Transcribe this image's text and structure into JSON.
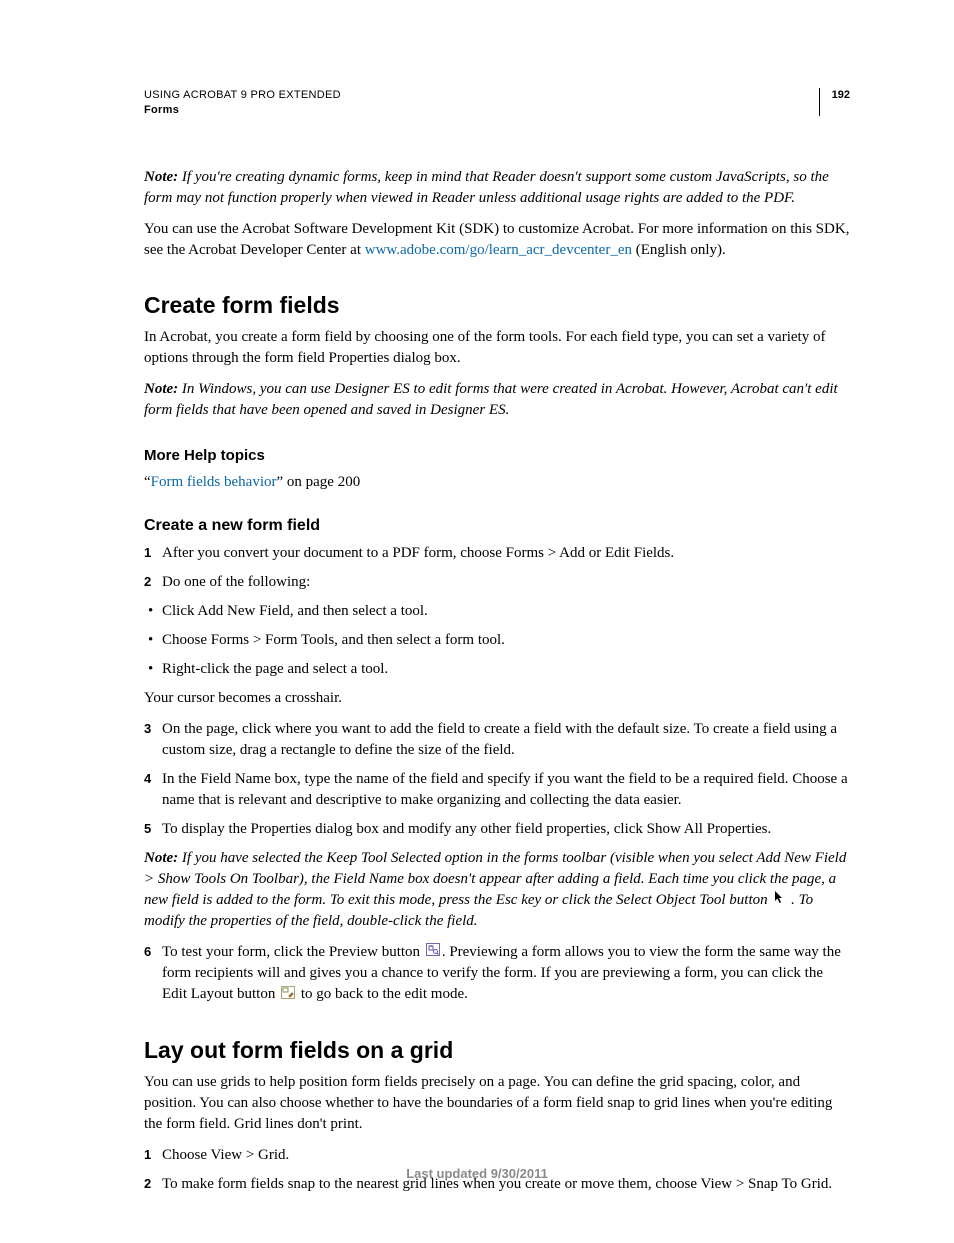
{
  "header": {
    "product": "USING ACROBAT 9 PRO EXTENDED",
    "section": "Forms",
    "pageNumber": "192"
  },
  "intro": {
    "noteLabel": "Note:",
    "noteText": " If you're creating dynamic forms, keep in mind that Reader doesn't support some custom JavaScripts, so the form may not function properly when viewed in Reader unless additional usage rights are added to the PDF.",
    "sdkPre": "You can use the Acrobat Software Development Kit (SDK) to customize Acrobat. For more information on this SDK, see the Acrobat Developer Center at ",
    "sdkLink": "www.adobe.com/go/learn_acr_devcenter_en",
    "sdkPost": " (English only)."
  },
  "createFields": {
    "h2": "Create form fields",
    "p1": "In Acrobat, you create a form field by choosing one of the form tools. For each field type, you can set a variety of options through the form field Properties dialog box.",
    "noteLabel": "Note:",
    "noteText": " In Windows, you can use Designer ES to edit forms that were created in Acrobat. However, Acrobat can't edit form fields that have been opened and saved in Designer ES.",
    "moreHelp": "More Help topics",
    "helpQuoteOpen": "“",
    "helpLink": "Form fields behavior",
    "helpTail": "” on page 200"
  },
  "createNew": {
    "h4": "Create a new form field",
    "step1": "After you convert your document to a PDF form, choose Forms > Add or Edit Fields.",
    "step2": "Do one of the following:",
    "bullets": [
      "Click Add New Field, and then select a tool.",
      "Choose Forms > Form Tools, and then select a form tool.",
      "Right-click the page and select a tool."
    ],
    "afterBullets": "Your cursor becomes a crosshair.",
    "step3": "On the page, click where you want to add the field to create a field with the default size. To create a field using a custom size, drag a rectangle to define the size of the field.",
    "step4": "In the Field Name box, type the name of the field and specify if you want the field to be a required field. Choose a name that is relevant and descriptive to make organizing and collecting the data easier.",
    "step5": "To display the Properties dialog box and modify any other field properties, click Show All Properties.",
    "noteLabel": "Note:",
    "noteBody1": " If you have selected the Keep Tool Selected option in the forms toolbar (visible when you select Add New Field > Show Tools On Toolbar), the Field Name box doesn't appear after adding a field. Each time you click the page, a new field is added to the form. To exit this mode, press the Esc key or click the Select Object Tool button ",
    "noteBody2": " . To modify the properties of the field, double-click the field.",
    "step6pre": "To test your form, click the Preview button ",
    "step6mid": ". Previewing a form allows you to view the form the same way the form recipients will and gives you a chance to verify the form. If you are previewing a form, you can click the Edit Layout button ",
    "step6post": " to go back to the edit mode."
  },
  "grid": {
    "h2": "Lay out form fields on a grid",
    "p1": "You can use grids to help position form fields precisely on a page. You can define the grid spacing, color, and position. You can also choose whether to have the boundaries of a form field snap to grid lines when you're editing the form field. Grid lines don't print.",
    "step1": "Choose View > Grid.",
    "step2": "To make form fields snap to the nearest grid lines when you create or move them, choose View > Snap To Grid."
  },
  "footer": "Last updated 9/30/2011"
}
